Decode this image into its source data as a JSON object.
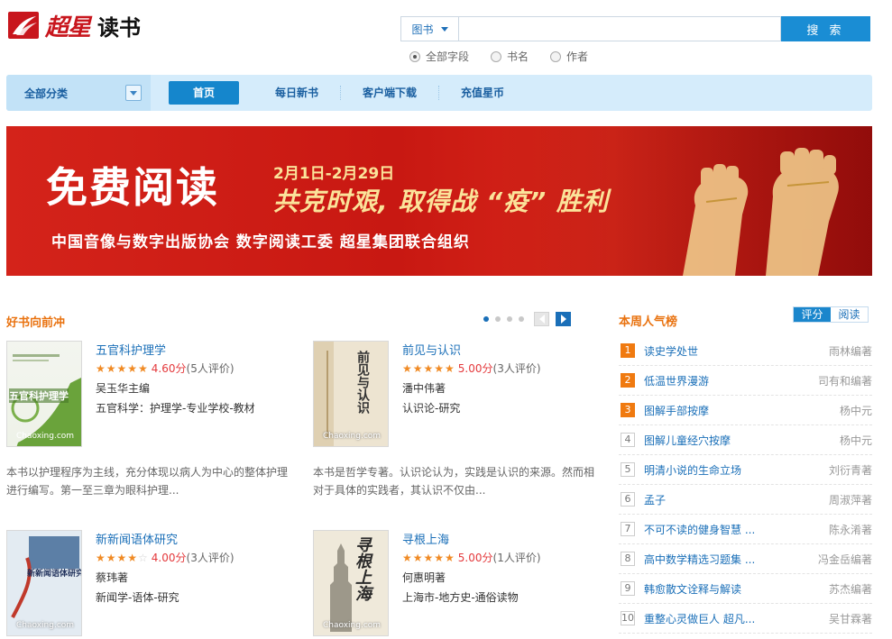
{
  "header": {
    "logo_text": "超星",
    "logo_sub": "读书",
    "search": {
      "type_label": "图书",
      "placeholder": "",
      "button": "搜 索",
      "scope": [
        {
          "label": "全部字段",
          "checked": true
        },
        {
          "label": "书名",
          "checked": false
        },
        {
          "label": "作者",
          "checked": false
        }
      ]
    }
  },
  "nav": {
    "category": "全部分类",
    "items": [
      "首页",
      "每日新书",
      "客户端下载",
      "充值星币"
    ],
    "active": 0
  },
  "banner": {
    "headline": "免费阅读",
    "date": "2月1日-2月29日",
    "slogan": "共克时艰, 取得战 “疫” 胜利",
    "org": "中国音像与数字出版协会  数字阅读工委  超星集团联合组织"
  },
  "featured": {
    "title": "好书向前冲",
    "books": [
      {
        "title": "五官科护理学",
        "stars": 5,
        "score": "4.60分",
        "count": "(5人评价)",
        "author": "吴玉华主编",
        "subject": "五官科学：护理学-专业学校-教材",
        "desc": "本书以护理程序为主线，充分体现以病人为中心的整体护理进行编写。第一至三章为眼科护理...",
        "cover_text": "五官科护理学",
        "cover_mark": "Chaoxing.com"
      },
      {
        "title": "前见与认识",
        "stars": 5,
        "score": "5.00分",
        "count": "(3人评价)",
        "author": "潘中伟著",
        "subject": "认识论-研究",
        "desc": "本书是哲学专著。认识论认为，实践是认识的来源。然而相对于具体的实践者，其认识不仅由...",
        "cover_text": "前见与认识",
        "cover_mark": "Chaoxing.com"
      },
      {
        "title": "新新闻语体研究",
        "stars": 4,
        "score": "4.00分",
        "count": "(3人评价)",
        "author": "蔡玮著",
        "subject": "新闻学-语体-研究",
        "desc": "",
        "cover_text": "新新闻语体研究",
        "cover_mark": "Chaoxing.com"
      },
      {
        "title": "寻根上海",
        "stars": 5,
        "score": "5.00分",
        "count": "(1人评价)",
        "author": "何惠明著",
        "subject": "上海市-地方史-通俗读物",
        "desc": "",
        "cover_text": "寻根上海",
        "cover_mark": "Chaoxing.com"
      }
    ]
  },
  "ranking": {
    "title": "本周人气榜",
    "tabs": [
      "评分",
      "阅读"
    ],
    "active_tab": 0,
    "items": [
      {
        "num": "1",
        "name": "读史学处世",
        "author": "雨林编著"
      },
      {
        "num": "2",
        "name": "低温世界漫游",
        "author": "司有和编著"
      },
      {
        "num": "3",
        "name": "图解手部按摩",
        "author": "杨中元"
      },
      {
        "num": "4",
        "name": "图解儿童经穴按摩",
        "author": "杨中元"
      },
      {
        "num": "5",
        "name": "明清小说的生命立场",
        "author": "刘衍青著"
      },
      {
        "num": "6",
        "name": "孟子",
        "author": "周淑萍著"
      },
      {
        "num": "7",
        "name": "不可不读的健身智慧 ...",
        "author": "陈永淆著"
      },
      {
        "num": "8",
        "name": "高中数学精选习题集 ...",
        "author": "冯金岳编著"
      },
      {
        "num": "9",
        "name": "韩愈散文诠释与解读",
        "author": "苏杰编著"
      },
      {
        "num": "10",
        "name": "重整心灵做巨人 超凡...",
        "author": "吴甘霖著"
      }
    ]
  },
  "colors": {
    "accent": "#1a86cc",
    "brand_red": "#c8161d",
    "orange": "#f07a10"
  }
}
